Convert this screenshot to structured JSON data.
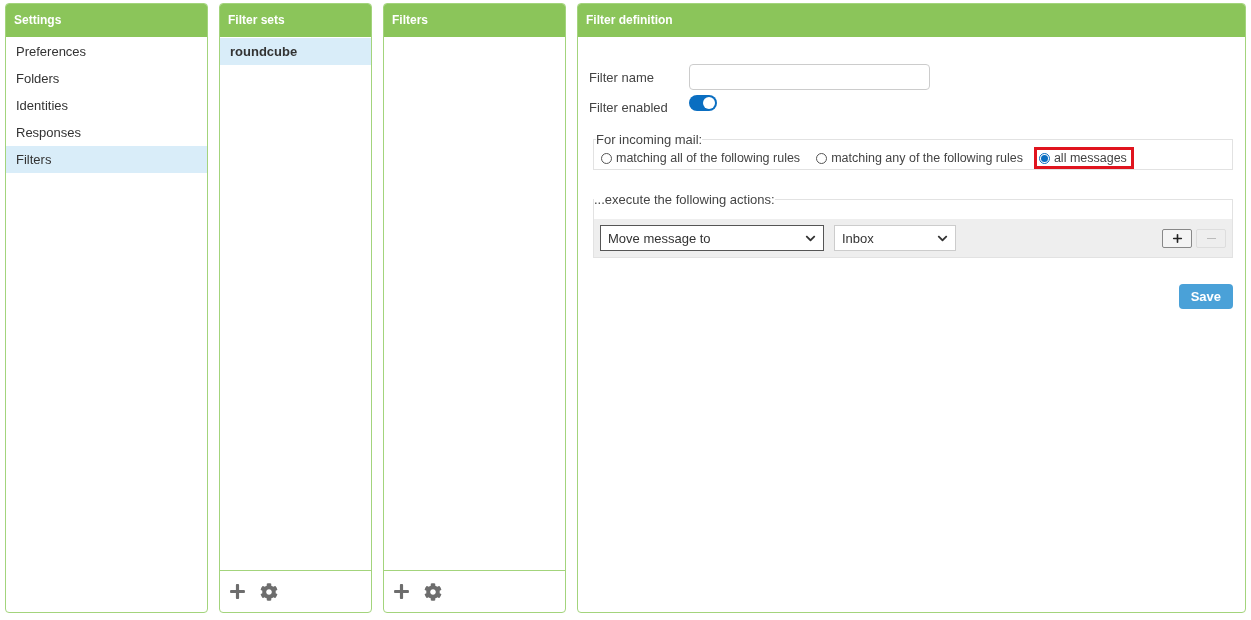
{
  "settings": {
    "title": "Settings",
    "items": [
      {
        "label": "Preferences",
        "selected": false
      },
      {
        "label": "Folders",
        "selected": false
      },
      {
        "label": "Identities",
        "selected": false
      },
      {
        "label": "Responses",
        "selected": false
      },
      {
        "label": "Filters",
        "selected": true
      }
    ]
  },
  "filter_sets": {
    "title": "Filter sets",
    "items": [
      {
        "label": "roundcube",
        "selected": true
      }
    ]
  },
  "filters": {
    "title": "Filters"
  },
  "filter_definition": {
    "title": "Filter definition",
    "name_field": {
      "label": "Filter name"
    },
    "enabled": {
      "label": "Filter enabled",
      "on": true
    },
    "incoming": {
      "legend": "For incoming mail:",
      "options": [
        {
          "label": "matching all of the following rules",
          "selected": false,
          "highlighted": false
        },
        {
          "label": "matching any of the following rules",
          "selected": false,
          "highlighted": false
        },
        {
          "label": "all messages",
          "selected": true,
          "highlighted": true
        }
      ]
    },
    "actions": {
      "legend": "...execute the following actions:",
      "rows": [
        {
          "action": "Move message to",
          "folder": "Inbox",
          "remove_disabled": true
        }
      ]
    },
    "save": "Save"
  }
}
